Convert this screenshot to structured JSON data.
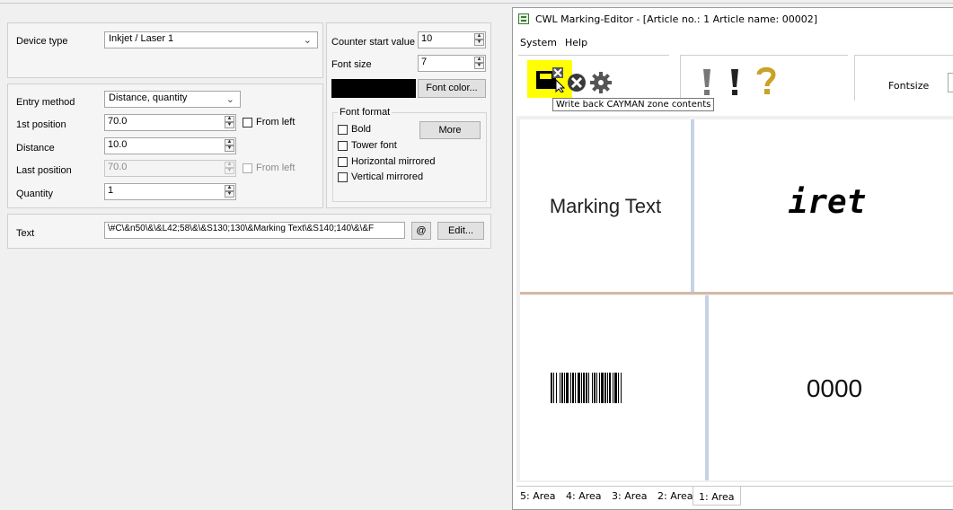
{
  "settings": {
    "device_type_label": "Device type",
    "device_type_value": "Inkjet / Laser 1",
    "counter_start_label": "Counter start value",
    "counter_start_value": "10",
    "font_size_label": "Font size",
    "font_size_value": "7",
    "font_color_button": "Font color...",
    "font_color_swatch": "#000000",
    "entry_method_label": "Entry method",
    "entry_method_value": "Distance, quantity",
    "first_position_label": "1st position",
    "first_position_value": "70.0",
    "from_left_label": "From left",
    "distance_label": "Distance",
    "distance_value": "10.0",
    "last_position_label": "Last position",
    "last_position_value": "70.0",
    "from_left_disabled_label": "From left",
    "quantity_label": "Quantity",
    "quantity_value": "1",
    "font_format_title": "Font format",
    "bold_label": "Bold",
    "tower_font_label": "Tower font",
    "horizontal_mirrored_label": "Horizontal mirrored",
    "vertical_mirrored_label": "Vertical mirrored",
    "more_button": "More",
    "text_label": "Text",
    "text_value": "\\#C\\&n50\\&\\&L42;58\\&\\&S130;130\\&Marking Text\\&S140;140\\&\\&F",
    "at_button": "@",
    "edit_button": "Edit..."
  },
  "editor": {
    "title": "CWL Marking-Editor - [Article no.: 1    Article name: 00002]",
    "menu": [
      "System",
      "Help"
    ],
    "tooltip": "Write back CAYMAN zone contents",
    "fontsize_label": "Fontsize",
    "highlight_color": "#ffff00",
    "question_color": "#c9a227",
    "zones": {
      "zone1_text": "Marking Text",
      "zone2_text": "iret",
      "zone4_text": "0000"
    },
    "tabs": [
      "5: Area",
      "4: Area",
      "3: Area",
      "2: Area",
      "1: Area"
    ],
    "icons": [
      "save-icon",
      "cancel-icon",
      "gear-icon",
      "exclamation-icon",
      "exclamation-icon",
      "question-icon"
    ]
  }
}
